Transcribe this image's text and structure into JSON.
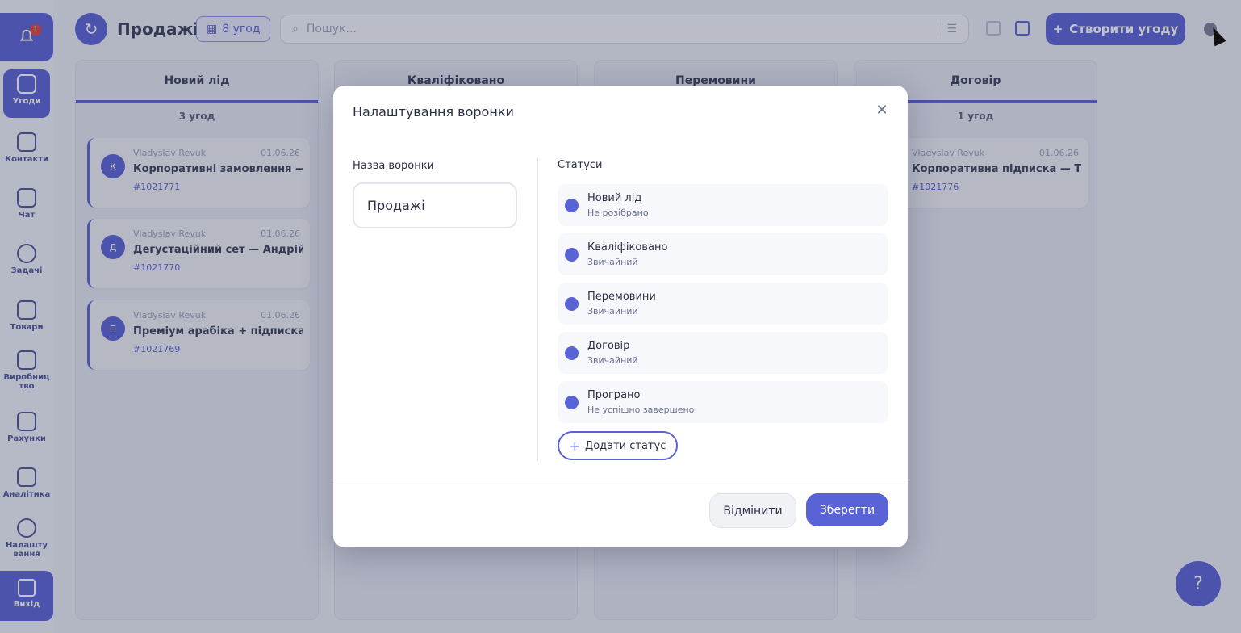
{
  "sidebar": {
    "notification_badge": "1",
    "items": [
      {
        "label": "Угоди",
        "icon": "deals-icon"
      },
      {
        "label": "Контакти",
        "icon": "contacts-icon"
      },
      {
        "label": "Чат",
        "icon": "chat-icon"
      },
      {
        "label": "Задачі",
        "icon": "tasks-icon"
      },
      {
        "label": "Товари",
        "icon": "products-icon"
      },
      {
        "label": "Виробниц тво",
        "icon": "production-icon"
      },
      {
        "label": "Рахунки",
        "icon": "invoices-icon"
      },
      {
        "label": "Аналітика",
        "icon": "analytics-icon"
      },
      {
        "label": "Налашту вання",
        "icon": "settings-icon"
      }
    ],
    "exit_label": "Вихід"
  },
  "header": {
    "title": "Продажі",
    "deal_count": "8 угод",
    "search_placeholder": "Пошук...",
    "create_button": "Створити угоду"
  },
  "board": {
    "columns": [
      {
        "name": "Новий лід",
        "count": "3 угод"
      },
      {
        "name": "Кваліфіковано",
        "count": ""
      },
      {
        "name": "Перемовини",
        "count": ""
      },
      {
        "name": "Договір",
        "count": "1 угод"
      }
    ],
    "cards": [
      {
        "avatar": "К",
        "author": "Vladyslav Revuk",
        "date": "01.06.26",
        "title": "Корпоративні замовлення —...",
        "number": "#1021771"
      },
      {
        "avatar": "Д",
        "author": "Vladyslav Revuk",
        "date": "01.06.26",
        "title": "Дегустаційний сет — Андрій ...",
        "number": "#1021770"
      },
      {
        "avatar": "П",
        "author": "Vladyslav Revuk",
        "date": "01.06.26",
        "title": "Преміум арабіка + підписка ...",
        "number": "#1021769"
      },
      {
        "avatar": "",
        "author": "Vladyslav Revuk",
        "date": "01.06.26",
        "title": "Корпоративна підписка — Т...",
        "number": "#1021776"
      }
    ]
  },
  "modal": {
    "title": "Налаштування воронки",
    "name_label": "Назва воронки",
    "name_value": "Продажі",
    "statuses_label": "Статуси",
    "statuses": [
      {
        "name": "Новий лід",
        "type": "Не розібрано"
      },
      {
        "name": "Кваліфіковано",
        "type": "Звичайний"
      },
      {
        "name": "Перемовини",
        "type": "Звичайний"
      },
      {
        "name": "Договір",
        "type": "Звичайний"
      },
      {
        "name": "Програно",
        "type": "Не успішно завершено"
      }
    ],
    "add_status": "Додати статус",
    "cancel": "Відмінити",
    "save": "Зберегти"
  },
  "colors": {
    "accent": "#5a63d6"
  }
}
